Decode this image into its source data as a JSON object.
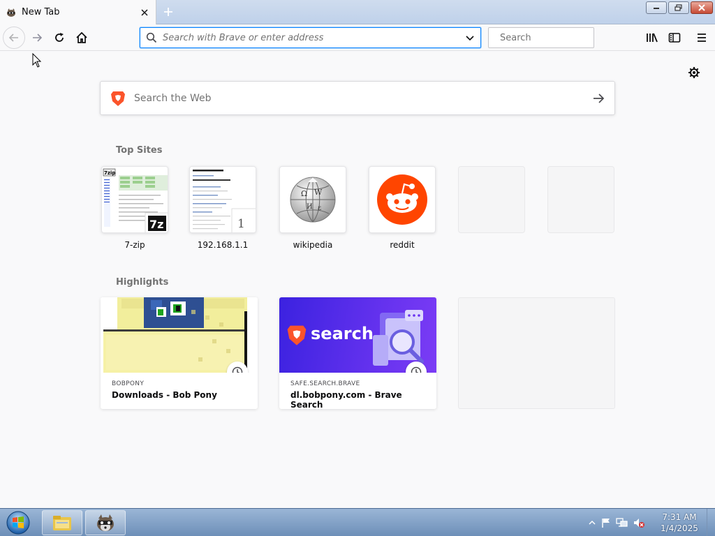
{
  "tab": {
    "title": "New Tab"
  },
  "toolbar": {
    "url_placeholder": "Search with Brave or enter address",
    "search_placeholder": "Search"
  },
  "page": {
    "websearch_placeholder": "Search the Web",
    "top_sites_title": "Top Sites",
    "top_sites": [
      {
        "label": "7-zip"
      },
      {
        "label": "192.168.1.1",
        "badge": "1"
      },
      {
        "label": "wikipedia"
      },
      {
        "label": "reddit"
      }
    ],
    "highlights_title": "Highlights",
    "highlights": [
      {
        "source": "BOBPONY",
        "title": "Downloads - Bob Pony"
      },
      {
        "source": "SAFE.SEARCH.BRAVE",
        "title": "dl.bobpony.com - Brave Search",
        "image_text": "search"
      }
    ]
  },
  "taskbar": {
    "time": "7:31 AM",
    "date": "1/4/2025"
  },
  "colors": {
    "accent": "#0a84ff",
    "brave": "#fb542b",
    "reddit": "#ff4500",
    "brave_search_bg": "#3b22e0"
  }
}
